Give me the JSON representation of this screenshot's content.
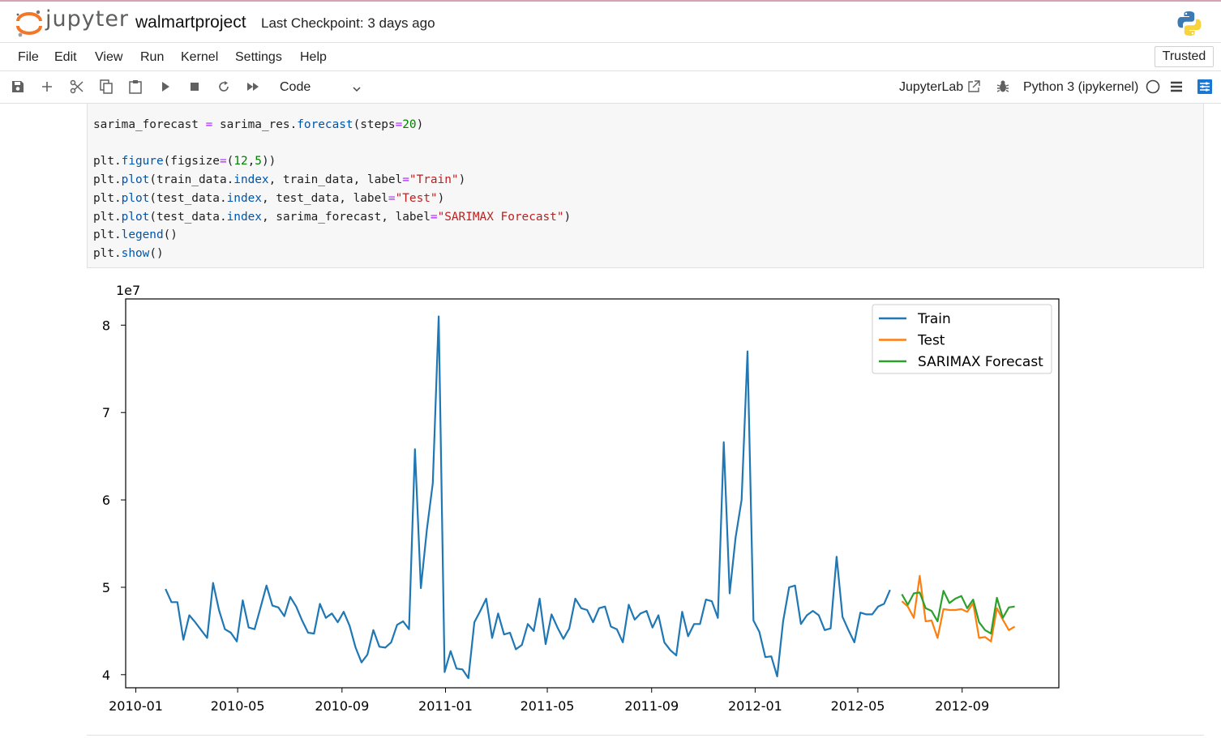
{
  "app": {
    "logo_text": "jupyter",
    "notebook_name": "walmartproject",
    "checkpoint": "Last Checkpoint: 3 days ago"
  },
  "menu": [
    "File",
    "Edit",
    "View",
    "Run",
    "Kernel",
    "Settings",
    "Help"
  ],
  "trusted_label": "Trusted",
  "toolbar": {
    "cell_type": "Code",
    "jupyterlab_label": "JupyterLab",
    "kernel_label": "Python 3 (ipykernel)"
  },
  "code": [
    "sarima_forecast = sarima_res.forecast(steps=20)",
    "",
    "plt.figure(figsize=(12,5))",
    "plt.plot(train_data.index, train_data, label=\"Train\")",
    "plt.plot(test_data.index, test_data, label=\"Test\")",
    "plt.plot(test_data.index, sarima_forecast, label=\"SARIMAX Forecast\")",
    "plt.legend()",
    "plt.show()"
  ],
  "colors": {
    "train": "#1f77b4",
    "test": "#ff7f0e",
    "forecast": "#2ca02c",
    "accent": "#1976d2"
  },
  "chart_data": {
    "type": "line",
    "title": "",
    "xlabel": "",
    "ylabel": "",
    "y_offset_label": "1e7",
    "ylim": [
      3.85,
      8.3
    ],
    "xlim": [
      "2009-12-20",
      "2012-12-24"
    ],
    "x_ticks": [
      "2010-01",
      "2010-05",
      "2010-09",
      "2011-01",
      "2011-05",
      "2011-09",
      "2012-01",
      "2012-05",
      "2012-09"
    ],
    "y_ticks": [
      4,
      5,
      6,
      7,
      8
    ],
    "legend_position": "upper-right",
    "grid": false,
    "series": [
      {
        "name": "Train",
        "start": "2010-02-05",
        "freq_days": 7,
        "values": [
          4.98,
          4.83,
          4.83,
          4.4,
          4.68,
          4.6,
          4.51,
          4.42,
          5.05,
          4.74,
          4.52,
          4.48,
          4.38,
          4.85,
          4.54,
          4.52,
          4.77,
          5.02,
          4.79,
          4.77,
          4.67,
          4.89,
          4.78,
          4.62,
          4.48,
          4.47,
          4.81,
          4.65,
          4.7,
          4.6,
          4.72,
          4.56,
          4.31,
          4.14,
          4.23,
          4.51,
          4.32,
          4.31,
          4.37,
          4.57,
          4.61,
          4.52,
          6.58,
          4.99,
          5.66,
          6.19,
          8.1,
          4.03,
          4.27,
          4.07,
          4.06,
          3.96,
          4.6,
          4.73,
          4.87,
          4.42,
          4.7,
          4.46,
          4.48,
          4.29,
          4.34,
          4.58,
          4.5,
          4.87,
          4.35,
          4.69,
          4.54,
          4.41,
          4.53,
          4.87,
          4.76,
          4.74,
          4.6,
          4.76,
          4.78,
          4.55,
          4.52,
          4.37,
          4.8,
          4.63,
          4.7,
          4.73,
          4.54,
          4.68,
          4.37,
          4.28,
          4.22,
          4.72,
          4.44,
          4.58,
          4.58,
          4.86,
          4.84,
          4.65,
          6.66,
          4.93,
          5.57,
          6.0,
          7.7,
          4.62,
          4.49,
          4.2,
          4.21,
          3.98,
          4.61,
          5.0,
          5.02,
          4.58,
          4.68,
          4.73,
          4.68,
          4.51,
          4.53,
          5.35,
          4.66,
          4.51,
          4.37,
          4.71,
          4.69,
          4.69,
          4.78,
          4.81,
          4.97
        ]
      },
      {
        "name": "Test",
        "start": "2012-06-22",
        "freq_days": 7,
        "values": [
          4.84,
          4.78,
          4.65,
          5.13,
          4.61,
          4.62,
          4.42,
          4.75,
          4.74,
          4.74,
          4.75,
          4.72,
          4.82,
          4.42,
          4.43,
          4.38,
          4.76,
          4.63,
          4.51,
          4.55
        ]
      },
      {
        "name": "SARIMAX Forecast",
        "start": "2012-06-22",
        "freq_days": 7,
        "values": [
          4.92,
          4.8,
          4.93,
          4.94,
          4.76,
          4.73,
          4.61,
          4.96,
          4.82,
          4.87,
          4.9,
          4.76,
          4.86,
          4.6,
          4.51,
          4.47,
          4.88,
          4.65,
          4.77,
          4.78
        ]
      }
    ]
  }
}
